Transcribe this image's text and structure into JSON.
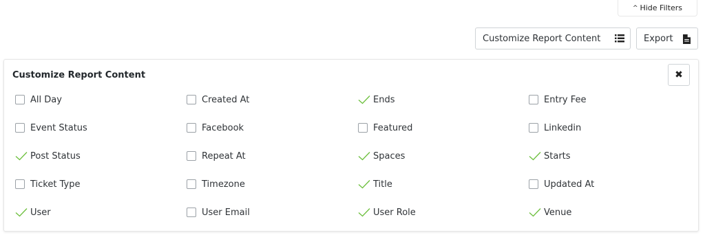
{
  "toolbar": {
    "hide_filters_label": "Hide Filters",
    "customize_label": "Customize Report Content",
    "export_label": "Export"
  },
  "panel": {
    "title": "Customize Report Content",
    "close_label": "✖",
    "options": [
      {
        "label": "All Day",
        "checked": false
      },
      {
        "label": "Created At",
        "checked": false
      },
      {
        "label": "Ends",
        "checked": true
      },
      {
        "label": "Entry Fee",
        "checked": false
      },
      {
        "label": "Event Status",
        "checked": false
      },
      {
        "label": "Facebook",
        "checked": false
      },
      {
        "label": "Featured",
        "checked": false
      },
      {
        "label": "Linkedin",
        "checked": false
      },
      {
        "label": "Post Status",
        "checked": true
      },
      {
        "label": "Repeat At",
        "checked": false
      },
      {
        "label": "Spaces",
        "checked": true
      },
      {
        "label": "Starts",
        "checked": true
      },
      {
        "label": "Ticket Type",
        "checked": false
      },
      {
        "label": "Timezone",
        "checked": false
      },
      {
        "label": "Title",
        "checked": true
      },
      {
        "label": "Updated At",
        "checked": false
      },
      {
        "label": "User",
        "checked": true
      },
      {
        "label": "User Email",
        "checked": false
      },
      {
        "label": "User Role",
        "checked": true
      },
      {
        "label": "Venue",
        "checked": true
      }
    ]
  },
  "colors": {
    "check": "#6cbf3c"
  },
  "icons": {
    "customize": "list-icon",
    "export": "file-icon",
    "hide_filters": "caret-up-icon",
    "close": "close-icon"
  }
}
